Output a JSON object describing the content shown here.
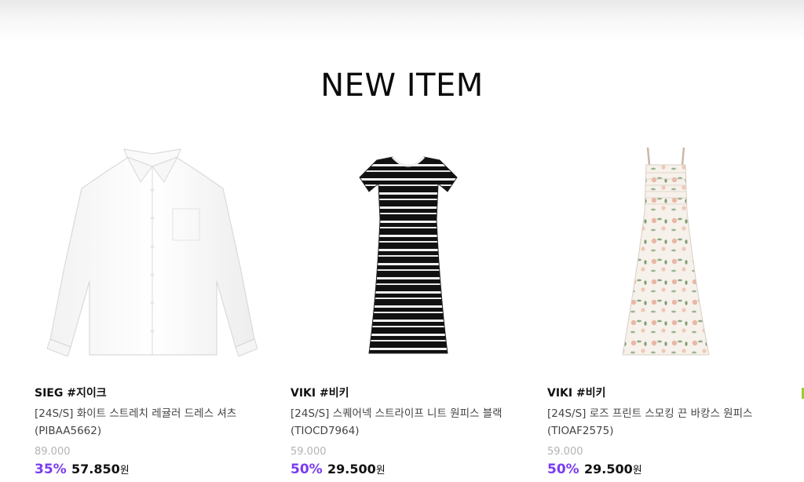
{
  "section": {
    "title": "NEW ITEM"
  },
  "products": [
    {
      "brand": "SIEG #지이크",
      "name_line1": "[24S/S] 화이트 스트레치 레귤러 드레스 셔츠",
      "name_line2": "(PIBAA5662)",
      "original_price": "89.000",
      "discount": "35%",
      "sale_price": "57.850",
      "currency": "원",
      "image": "white-dress-shirt"
    },
    {
      "brand": "VIKI #비키",
      "name_line1": "[24S/S] 스퀘어넥 스트라이프 니트 원피스 블랙",
      "name_line2": "(TIOCD7964)",
      "original_price": "59.000",
      "discount": "50%",
      "sale_price": "29.500",
      "currency": "원",
      "image": "striped-knit-dress"
    },
    {
      "brand": "VIKI #비키",
      "name_line1": "[24S/S] 로즈 프린트 스모킹 끈 바캉스 원피스",
      "name_line2": "(TIOAF2575)",
      "original_price": "59.000",
      "discount": "50%",
      "sale_price": "29.500",
      "currency": "원",
      "image": "floral-smocked-dress"
    }
  ],
  "colors": {
    "discount": "#7a3cf0",
    "original_price": "#b3b3b3"
  }
}
